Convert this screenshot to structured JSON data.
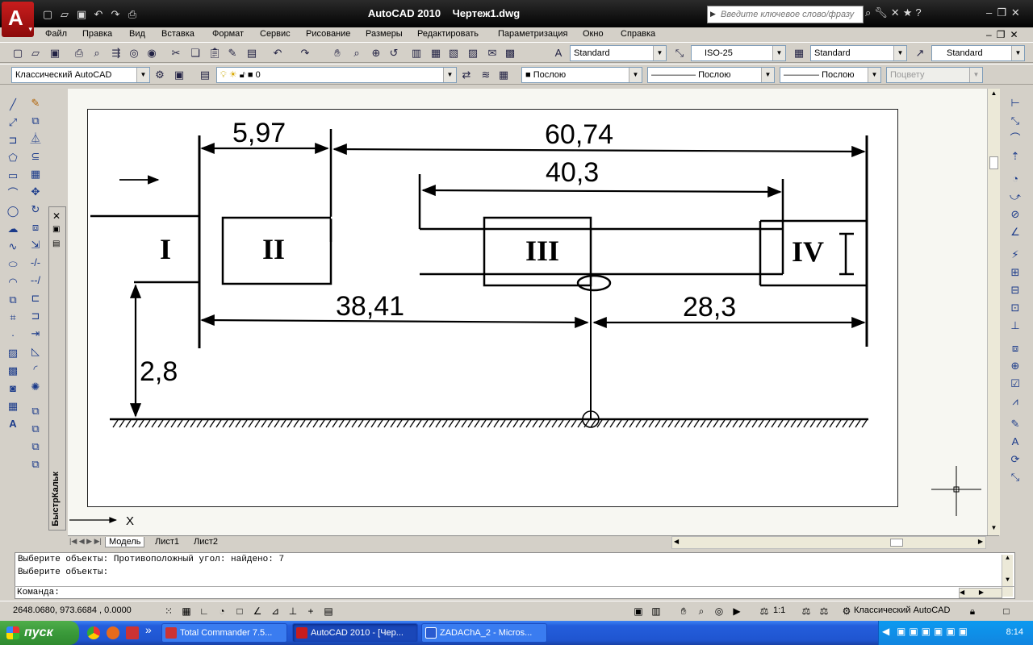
{
  "title_bar": {
    "app_title": "AutoCAD 2010",
    "doc_title": "Чертеж1.dwg",
    "search_placeholder": "Введите ключевое слово/фразу"
  },
  "menu": [
    "Файл",
    "Правка",
    "Вид",
    "Вставка",
    "Формат",
    "Сервис",
    "Рисование",
    "Размеры",
    "Редактировать",
    "Параметризация",
    "Окно",
    "Справка"
  ],
  "styles_toolbar": {
    "text_style": "Standard",
    "dim_style": "ISO-25",
    "table_style": "Standard",
    "mleader_style": "Standard"
  },
  "layers_toolbar": {
    "workspace": "Классический AutoCAD",
    "layer": "0",
    "color": "Послою",
    "linetype": "Послою",
    "lineweight": "Послою",
    "plotstyle": "Поцвету"
  },
  "drawing": {
    "dimensions": [
      "5,97",
      "60,74",
      "40,3",
      "38,41",
      "28,3",
      "2,8"
    ],
    "sections": [
      "I",
      "II",
      "III",
      "IV"
    ],
    "axis_label": "X"
  },
  "palette": {
    "calc_title": "БыстрКальк"
  },
  "tabs": [
    "Модель",
    "Лист1",
    "Лист2"
  ],
  "command_line": {
    "history": [
      "Выберите объекты: Противоположный угол: найдено: 7",
      "Выберите объекты:"
    ],
    "prompt": "Команда:"
  },
  "status_bar": {
    "coordinates": "2648.0680, 973.6684 , 0.0000",
    "annotation_scale": "1:1",
    "workspace": "Классический AutoCAD"
  },
  "taskbar": {
    "start_label": "пуск",
    "tasks": [
      "Total Commander 7.5...",
      "AutoCAD 2010 - [Чер...",
      "ZADAChA_2 - Micros..."
    ],
    "clock": "8:14",
    "more": "»"
  },
  "colors": {
    "accent_red": "#c81d1d",
    "taskbar_blue": "#245edc",
    "start_green": "#3a9a3a"
  }
}
